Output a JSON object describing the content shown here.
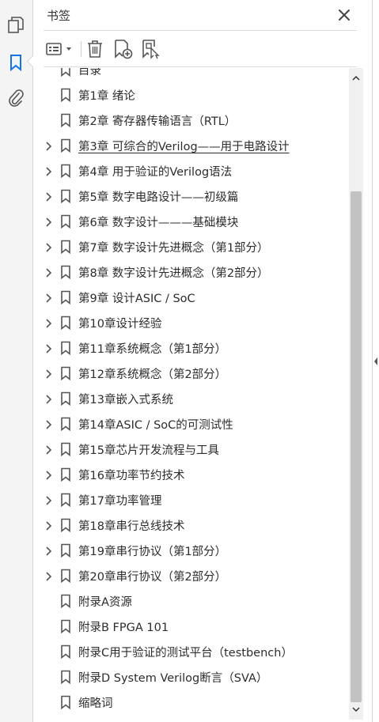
{
  "panel": {
    "title": "书签",
    "close_icon": "close-icon"
  },
  "rail": {
    "icons": [
      "pages-icon",
      "bookmark-icon",
      "attachment-icon"
    ]
  },
  "toolbar": {
    "icons": [
      "options-menu-icon",
      "delete-icon",
      "new-bookmark-icon",
      "bookmark-from-structure-icon"
    ]
  },
  "bookmarks": [
    {
      "label": "目录",
      "expandable": false,
      "selected": false
    },
    {
      "label": "第1章  绪论",
      "expandable": false,
      "selected": false
    },
    {
      "label": "第2章  寄存器传输语言（RTL）",
      "expandable": false,
      "selected": false
    },
    {
      "label": "第3章  可综合的Verilog——用于电路设计",
      "expandable": true,
      "selected": true
    },
    {
      "label": "第4章  用于验证的Verilog语法",
      "expandable": true,
      "selected": false
    },
    {
      "label": "第5章  数字电路设计——初级篇",
      "expandable": true,
      "selected": false
    },
    {
      "label": "第6章  数字设计———基础模块",
      "expandable": true,
      "selected": false
    },
    {
      "label": "第7章  数字设计先进概念（第1部分）",
      "expandable": true,
      "selected": false
    },
    {
      "label": "第8章  数字设计先进概念（第2部分）",
      "expandable": true,
      "selected": false
    },
    {
      "label": "第9章  设计ASIC / SoC",
      "expandable": true,
      "selected": false
    },
    {
      "label": "第10章设计经验",
      "expandable": true,
      "selected": false
    },
    {
      "label": "第11章系统概念（第1部分）",
      "expandable": true,
      "selected": false
    },
    {
      "label": "第12章系统概念（第2部分）",
      "expandable": true,
      "selected": false
    },
    {
      "label": "第13章嵌入式系统",
      "expandable": true,
      "selected": false
    },
    {
      "label": "第14章ASIC / SoC的可测试性",
      "expandable": true,
      "selected": false
    },
    {
      "label": "第15章芯片开发流程与工具",
      "expandable": true,
      "selected": false
    },
    {
      "label": "第16章功率节约技术",
      "expandable": true,
      "selected": false
    },
    {
      "label": "第17章功率管理",
      "expandable": true,
      "selected": false
    },
    {
      "label": "第18章串行总线技术",
      "expandable": true,
      "selected": false
    },
    {
      "label": "第19章串行协议（第1部分）",
      "expandable": true,
      "selected": false
    },
    {
      "label": "第20章串行协议（第2部分）",
      "expandable": true,
      "selected": false
    },
    {
      "label": "附录A资源",
      "expandable": false,
      "selected": false
    },
    {
      "label": "附录B  FPGA 101",
      "expandable": false,
      "selected": false
    },
    {
      "label": "附录C用于验证的测试平台（testbench）",
      "expandable": false,
      "selected": false
    },
    {
      "label": "附录D  System Verilog断言（SVA）",
      "expandable": false,
      "selected": false
    },
    {
      "label": "缩略词",
      "expandable": false,
      "selected": false
    }
  ],
  "colors": {
    "icon": "#555555",
    "accent": "#1473e6",
    "text": "#2c2c2c"
  }
}
